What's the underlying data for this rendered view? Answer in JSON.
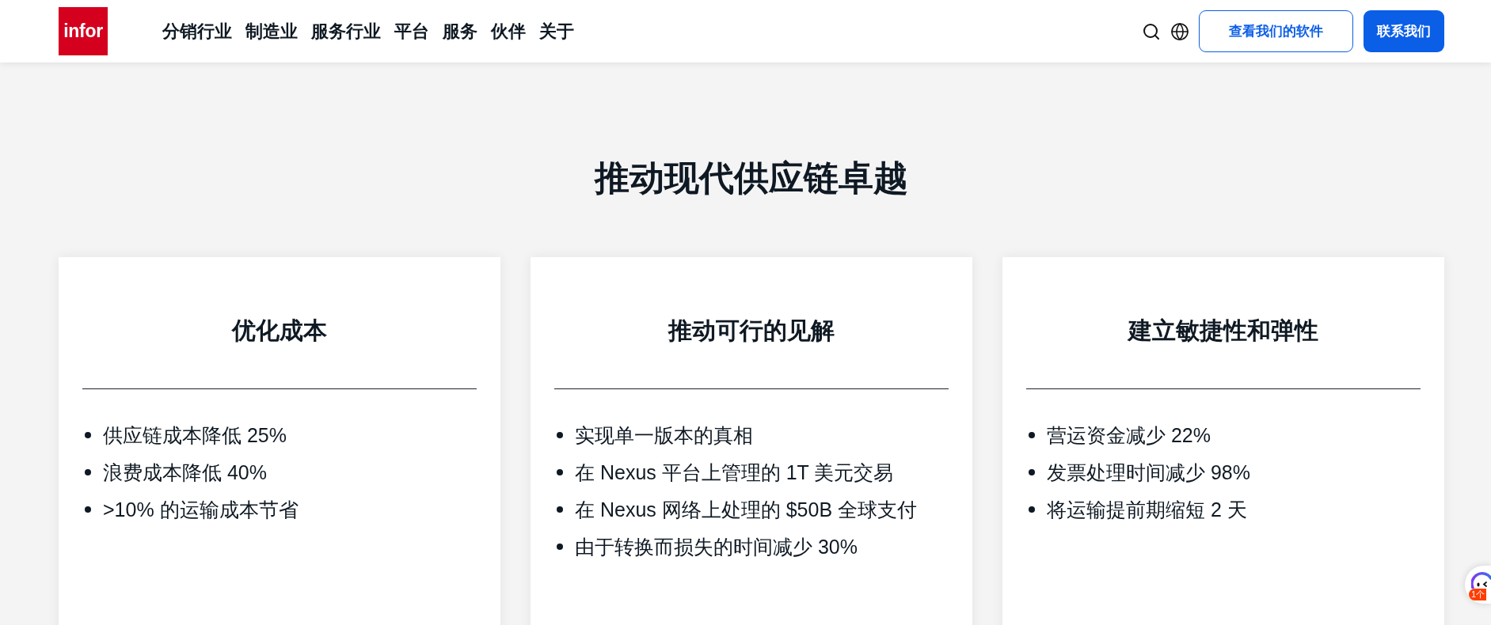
{
  "header": {
    "logo": "infor",
    "nav": [
      "分销行业",
      "制造业",
      "服务行业",
      "平台",
      "服务",
      "伙伴",
      "关于"
    ],
    "buttons": [
      {
        "label": "查看我们的软件",
        "kind": "outline"
      },
      {
        "label": "联系我们",
        "kind": "filled"
      }
    ]
  },
  "section": {
    "title": "推动现代供应链卓越",
    "cards": [
      {
        "title": "优化成本",
        "items": [
          "供应链成本降低 25%",
          "浪费成本降低 40%",
          ">10% 的运输成本节省"
        ]
      },
      {
        "title": "推动可行的见解",
        "items": [
          "实现单一版本的真相",
          "在 Nexus 平台上管理的 1T 美元交易",
          "在 Nexus 网络上处理的 $50B 全球支付",
          "由于转换而损失的时间减少 30%"
        ]
      },
      {
        "title": "建立敏捷性和弹性",
        "items": [
          "营运资金减少 22%",
          "发票处理时间减少 98%",
          "将运输提前期缩短 2 天"
        ]
      }
    ]
  },
  "floating_widget": {
    "badge": "1个"
  }
}
